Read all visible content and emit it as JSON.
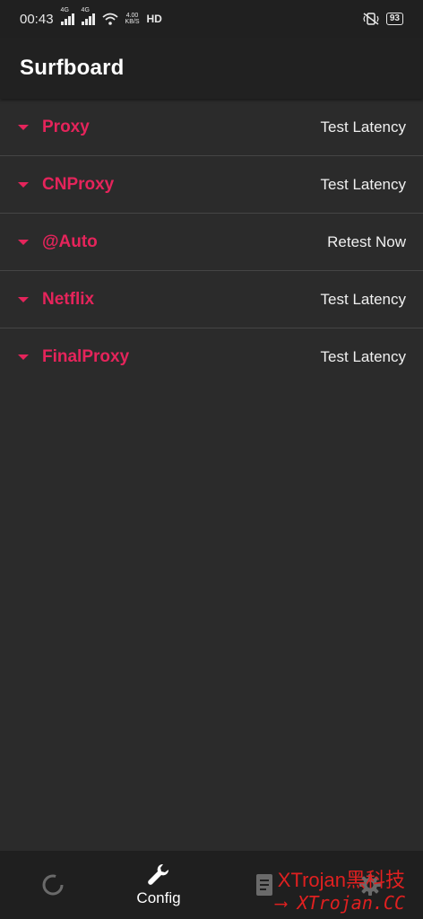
{
  "status_bar": {
    "time": "00:43",
    "sim1_tag": "4G",
    "sim2_tag": "4G",
    "net_speed_top": "4.00",
    "net_speed_bottom": "KB/S",
    "hd_label": "HD",
    "battery": "93"
  },
  "app_bar": {
    "title": "Surfboard"
  },
  "groups": [
    {
      "name": "Proxy",
      "action": "Test Latency"
    },
    {
      "name": "CNProxy",
      "action": "Test Latency"
    },
    {
      "name": "@Auto",
      "action": "Retest Now"
    },
    {
      "name": "Netflix",
      "action": "Test Latency"
    },
    {
      "name": "FinalProxy",
      "action": "Test Latency"
    }
  ],
  "bottom_nav": {
    "items": [
      {
        "icon": "loading-ring-icon",
        "label": ""
      },
      {
        "icon": "wrench-icon",
        "label": "Config"
      },
      {
        "icon": "document-icon",
        "label": ""
      },
      {
        "icon": "gear-icon",
        "label": ""
      }
    ]
  },
  "watermark": {
    "line1": "XTrojan黑科技",
    "line2": "XTrojan.CC"
  },
  "colors": {
    "accent": "#e5245b",
    "background": "#2b2b2b",
    "app_bar": "#212121",
    "status_bar": "#202020",
    "bottom_nav": "#1f1f1f",
    "watermark": "#e02020"
  }
}
